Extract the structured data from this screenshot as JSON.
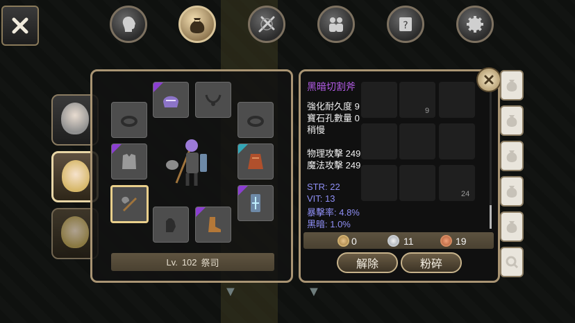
{
  "top_tabs": [
    {
      "icon": "head-silhouette-icon",
      "active": false
    },
    {
      "icon": "bag-icon",
      "active": true
    },
    {
      "icon": "crossed-swords-icon",
      "active": false
    },
    {
      "icon": "party-icon",
      "active": false
    },
    {
      "icon": "quest-scroll-icon",
      "active": false
    },
    {
      "icon": "gear-icon",
      "active": false
    }
  ],
  "portraits": [
    {
      "name": "white-hair-character",
      "active": false
    },
    {
      "name": "blonde-buns-character",
      "active": true
    },
    {
      "name": "blonde-buns-character-2",
      "active": false
    }
  ],
  "equipment": {
    "level_prefix": "Lv.",
    "level": "102",
    "class_name": "祭司",
    "slots": [
      {
        "icon": "helmet-icon",
        "rarity": "purple"
      },
      {
        "icon": "necklace-icon",
        "rarity": "none"
      },
      {
        "icon": "ring-icon",
        "rarity": "none"
      },
      {
        "icon": "ring-icon",
        "rarity": "none"
      },
      {
        "icon": "armor-icon",
        "rarity": "purple"
      },
      {
        "icon": "cloak-icon",
        "rarity": "cyan"
      },
      {
        "icon": "axe-icon",
        "rarity": "none",
        "selected": true
      },
      {
        "icon": "shield-icon",
        "rarity": "purple"
      },
      {
        "icon": "gloves-icon",
        "rarity": "none"
      },
      {
        "icon": "boots-icon",
        "rarity": "purple"
      }
    ]
  },
  "item_detail": {
    "title": "黑暗切割斧",
    "lines": [
      "強化耐久度 9",
      "寶石孔數量 0",
      "稍慢"
    ],
    "attacks": [
      "物理攻擊 249",
      "魔法攻擊 249"
    ],
    "stats": [
      "STR: 22",
      "VIT: 13",
      "暴擊率: 4.8%",
      "黑暗: 1.0%"
    ],
    "ghost_counts": [
      "9",
      "24"
    ]
  },
  "currency": {
    "gold": "0",
    "silver": "11",
    "bronze": "19"
  },
  "buttons": {
    "unequip": "解除",
    "shatter": "粉碎"
  },
  "colors": {
    "title_purple": "#b35ce6",
    "stat_blue": "#8f8ff5",
    "frame_gold": "#a99473"
  }
}
